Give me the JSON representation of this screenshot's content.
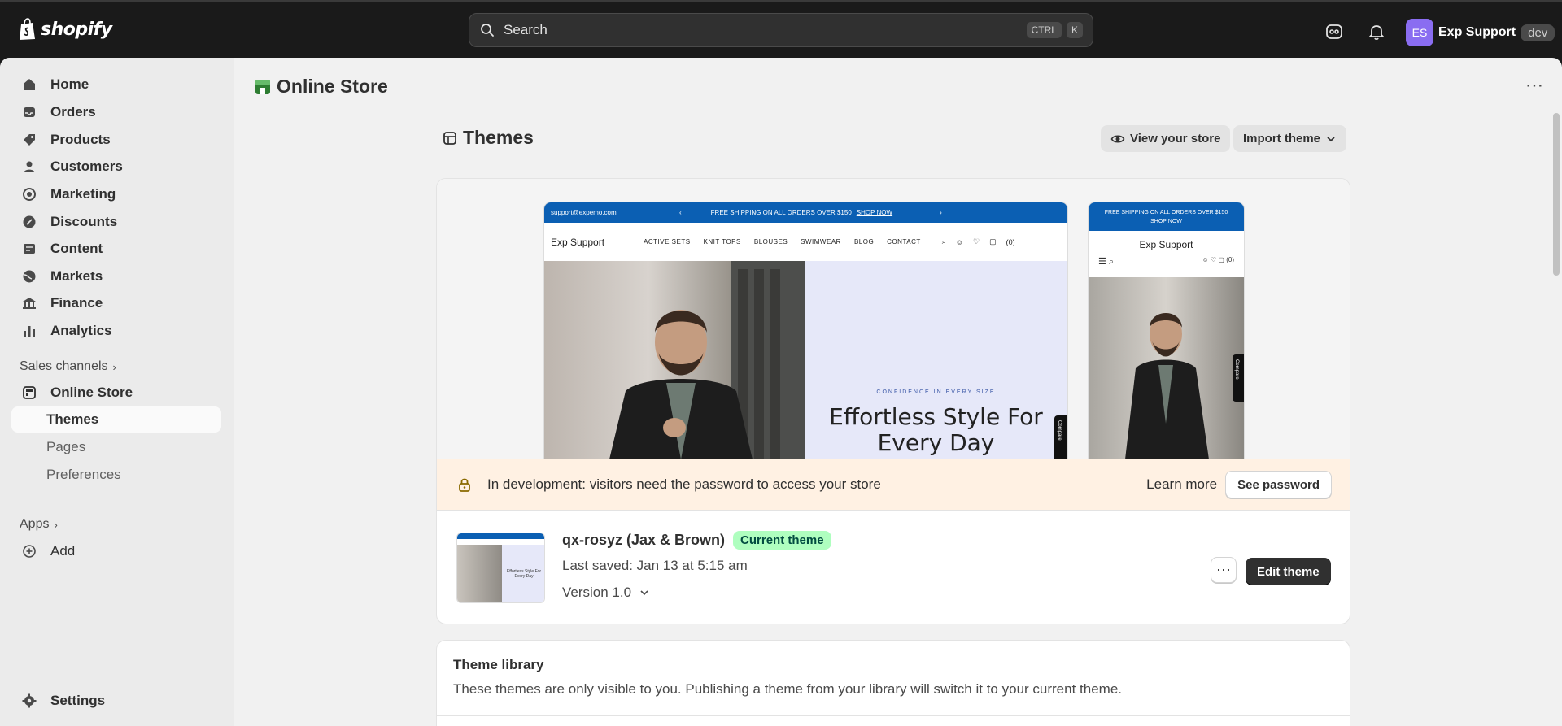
{
  "brand": {
    "name": "shopify"
  },
  "search": {
    "placeholder": "Search",
    "shortcut_key1": "CTRL",
    "shortcut_key2": "K"
  },
  "user": {
    "initials": "ES",
    "name": "Exp Support",
    "env_badge": "dev"
  },
  "sidebar": {
    "items": [
      {
        "label": "Home",
        "icon": "home-icon"
      },
      {
        "label": "Orders",
        "icon": "inbox-icon"
      },
      {
        "label": "Products",
        "icon": "tag-icon"
      },
      {
        "label": "Customers",
        "icon": "person-icon"
      },
      {
        "label": "Marketing",
        "icon": "target-icon"
      },
      {
        "label": "Discounts",
        "icon": "discount-icon"
      },
      {
        "label": "Content",
        "icon": "content-icon"
      },
      {
        "label": "Markets",
        "icon": "globe-icon"
      },
      {
        "label": "Finance",
        "icon": "bank-icon"
      },
      {
        "label": "Analytics",
        "icon": "bar-chart-icon"
      }
    ],
    "sales_channels_label": "Sales channels",
    "online_store_label": "Online Store",
    "sub_items": [
      "Themes",
      "Pages",
      "Preferences"
    ],
    "apps_label": "Apps",
    "add_label": "Add",
    "settings_label": "Settings"
  },
  "page": {
    "title": "Online Store",
    "section_title": "Themes",
    "view_store_label": "View your store",
    "import_theme_label": "Import theme"
  },
  "preview": {
    "desktop": {
      "email": "support@expemo.com",
      "announcement": "FREE SHIPPING ON ALL ORDERS OVER $150",
      "announcement_link": "SHOP NOW",
      "store_name": "Exp Support",
      "menu": [
        "ACTIVE SETS",
        "KNIT TOPS",
        "BLOUSES",
        "SWIMWEAR",
        "BLOG",
        "CONTACT"
      ],
      "cart_count": "(0)",
      "kicker": "CONFIDENCE IN EVERY SIZE",
      "hero_title": "Effortless Style For Every Day",
      "compare_tab": "Compare"
    },
    "mobile": {
      "announcement": "FREE SHIPPING ON ALL ORDERS OVER $150",
      "announcement_link": "SHOP NOW",
      "store_name": "Exp Support",
      "cart_count": "(0)",
      "compare_tab": "Compare"
    }
  },
  "alert": {
    "text": "In development: visitors need the password to access your store",
    "learn_more": "Learn more",
    "see_password": "See password"
  },
  "current_theme": {
    "name": "qx-rosyz (Jax & Brown)",
    "badge": "Current theme",
    "last_saved": "Last saved: Jan 13 at 5:15 am",
    "version": "Version 1.0",
    "edit_label": "Edit theme",
    "thumb_title": "Effortless Style For Every Day"
  },
  "library": {
    "title": "Theme library",
    "description": "These themes are only visible to you. Publishing a theme from your library will switch it to your current theme."
  },
  "colors": {
    "accent_purple": "#8a6df1",
    "badge_green": "#affebf",
    "alert_bg": "#fff1e3",
    "topbar": "#1a1a1a"
  }
}
